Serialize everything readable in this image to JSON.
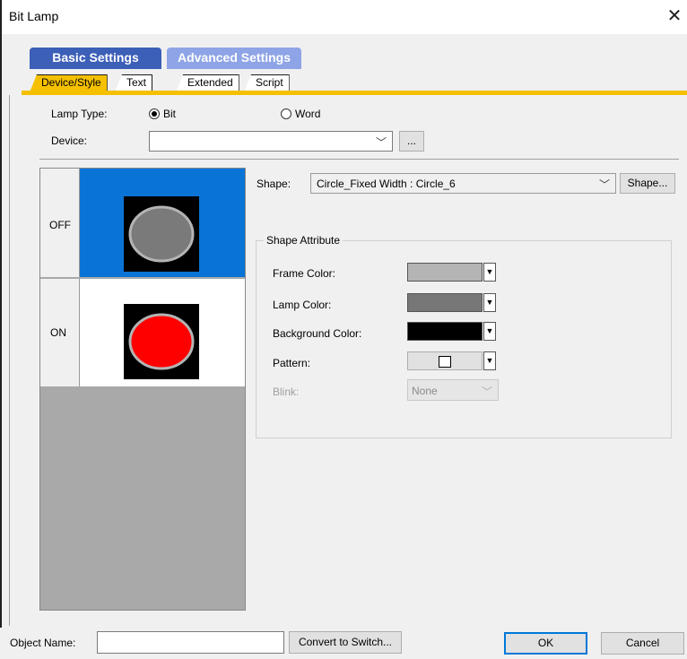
{
  "window": {
    "title": "Bit Lamp",
    "close_glyph": "✕"
  },
  "tabgroups": {
    "basic": "Basic Settings",
    "advanced": "Advanced Settings"
  },
  "tabs": [
    {
      "label": "Device/Style",
      "active": true
    },
    {
      "label": "Text",
      "active": false
    },
    {
      "label": "Extended",
      "active": false
    },
    {
      "label": "Script",
      "active": false
    }
  ],
  "lamp_type": {
    "label": "Lamp Type:",
    "option_bit": "Bit",
    "option_word": "Word",
    "selected": "Bit"
  },
  "device": {
    "label": "Device:",
    "value": "",
    "browse_label": "..."
  },
  "states": {
    "off_label": "OFF",
    "on_label": "ON"
  },
  "shape": {
    "label": "Shape:",
    "value": "Circle_Fixed Width : Circle_6",
    "button_label": "Shape..."
  },
  "shape_attribute": {
    "title": "Shape Attribute",
    "frame_color_label": "Frame Color:",
    "lamp_color_label": "Lamp Color:",
    "background_color_label": "Background Color:",
    "pattern_label": "Pattern:",
    "blink_label": "Blink:",
    "blink_value": "None"
  },
  "colors": {
    "frame_color": "#b4b4b4",
    "lamp_color": "#777777",
    "background_color": "#000000",
    "off_lamp": "#7a7a7a",
    "on_lamp": "#ff0000",
    "selected_state_bg": "#0a74d6"
  },
  "bottom": {
    "object_name_label": "Object Name:",
    "object_name_value": "",
    "convert_label": "Convert to Switch...",
    "ok_label": "OK",
    "cancel_label": "Cancel"
  }
}
